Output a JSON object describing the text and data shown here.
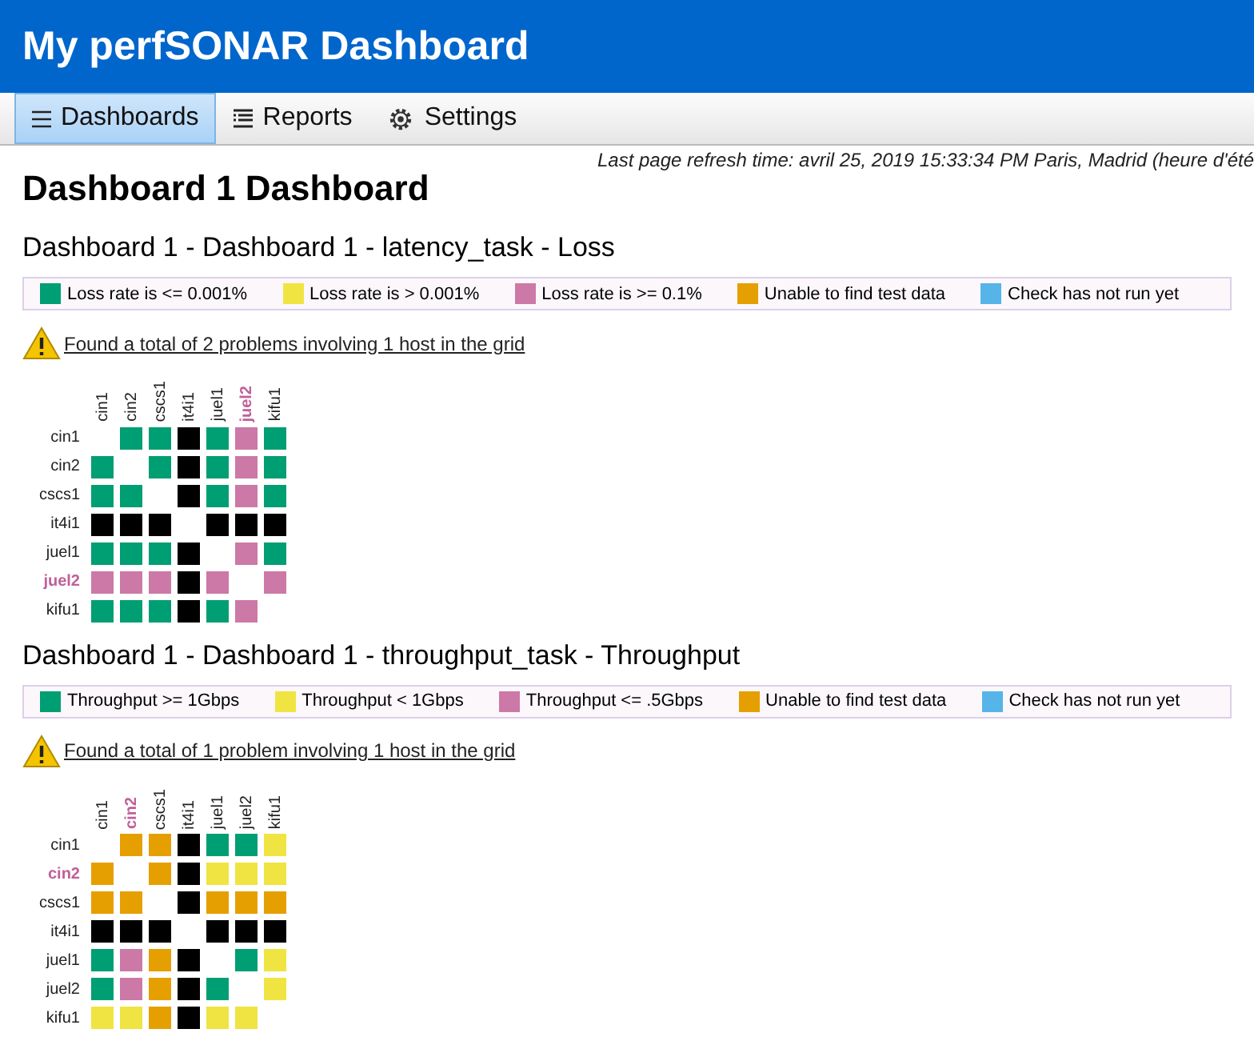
{
  "header": {
    "title": "My perfSONAR Dashboard"
  },
  "nav": [
    {
      "label": "Dashboards",
      "kind": "menu",
      "selected": true
    },
    {
      "label": "Reports",
      "kind": "list",
      "selected": false
    },
    {
      "label": "Settings",
      "kind": "gear",
      "selected": false
    }
  ],
  "refresh_text": "Last page refresh time: avril 25, 2019 15:33:34 PM Paris, Madrid (heure d'été",
  "page_title": "Dashboard 1 Dashboard",
  "sections": [
    {
      "title": "Dashboard 1 - Dashboard 1 - latency_task - Loss",
      "legend": [
        {
          "label": "Loss rate is <= 0.001%",
          "color": "#009e73"
        },
        {
          "label": "Loss rate is > 0.001%",
          "color": "#f0e442"
        },
        {
          "label": "Loss rate is >= 0.1%",
          "color": "#cc79a7"
        },
        {
          "label": "Unable to find test data",
          "color": "#e69f00"
        },
        {
          "label": "Check has not run yet",
          "color": "#56b4e9"
        }
      ],
      "problem_text": "Found a total of 2 problems involving 1 host in the grid",
      "columns": [
        {
          "label": "cin1",
          "flagged": false
        },
        {
          "label": "cin2",
          "flagged": false
        },
        {
          "label": "cscs1",
          "flagged": false
        },
        {
          "label": "it4i1",
          "flagged": false
        },
        {
          "label": "juel1",
          "flagged": false
        },
        {
          "label": "juel2",
          "flagged": true
        },
        {
          "label": "kifu1",
          "flagged": false
        }
      ],
      "rows": [
        {
          "label": "cin1",
          "flagged": false,
          "cells": [
            {
              "kind": "empty"
            },
            {
              "kind": "status",
              "color": "#009e73"
            },
            {
              "kind": "status",
              "color": "#009e73"
            },
            {
              "kind": "status",
              "color": "#000000"
            },
            {
              "kind": "status",
              "color": "#009e73"
            },
            {
              "kind": "status",
              "color": "#cc79a7"
            },
            {
              "kind": "status",
              "color": "#009e73"
            }
          ]
        },
        {
          "label": "cin2",
          "flagged": false,
          "cells": [
            {
              "kind": "status",
              "color": "#009e73"
            },
            {
              "kind": "empty"
            },
            {
              "kind": "status",
              "color": "#009e73"
            },
            {
              "kind": "status",
              "color": "#000000"
            },
            {
              "kind": "status",
              "color": "#009e73"
            },
            {
              "kind": "status",
              "color": "#cc79a7"
            },
            {
              "kind": "status",
              "color": "#009e73"
            }
          ]
        },
        {
          "label": "cscs1",
          "flagged": false,
          "cells": [
            {
              "kind": "status",
              "color": "#009e73"
            },
            {
              "kind": "status",
              "color": "#009e73"
            },
            {
              "kind": "empty"
            },
            {
              "kind": "status",
              "color": "#000000"
            },
            {
              "kind": "status",
              "color": "#009e73"
            },
            {
              "kind": "status",
              "color": "#cc79a7"
            },
            {
              "kind": "status",
              "color": "#009e73"
            }
          ]
        },
        {
          "label": "it4i1",
          "flagged": false,
          "cells": [
            {
              "kind": "status",
              "color": "#000000"
            },
            {
              "kind": "status",
              "color": "#000000"
            },
            {
              "kind": "status",
              "color": "#000000"
            },
            {
              "kind": "empty"
            },
            {
              "kind": "status",
              "color": "#000000"
            },
            {
              "kind": "status",
              "color": "#000000"
            },
            {
              "kind": "status",
              "color": "#000000"
            }
          ]
        },
        {
          "label": "juel1",
          "flagged": false,
          "cells": [
            {
              "kind": "status",
              "color": "#009e73"
            },
            {
              "kind": "status",
              "color": "#009e73"
            },
            {
              "kind": "status",
              "color": "#009e73"
            },
            {
              "kind": "status",
              "color": "#000000"
            },
            {
              "kind": "empty"
            },
            {
              "kind": "status",
              "color": "#cc79a7"
            },
            {
              "kind": "status",
              "color": "#009e73"
            }
          ]
        },
        {
          "label": "juel2",
          "flagged": true,
          "cells": [
            {
              "kind": "status",
              "color": "#cc79a7"
            },
            {
              "kind": "status",
              "color": "#cc79a7"
            },
            {
              "kind": "status",
              "color": "#cc79a7"
            },
            {
              "kind": "status",
              "color": "#000000"
            },
            {
              "kind": "status",
              "color": "#cc79a7"
            },
            {
              "kind": "empty"
            },
            {
              "kind": "status",
              "color": "#cc79a7"
            }
          ]
        },
        {
          "label": "kifu1",
          "flagged": false,
          "cells": [
            {
              "kind": "status",
              "color": "#009e73"
            },
            {
              "kind": "status",
              "color": "#009e73"
            },
            {
              "kind": "status",
              "color": "#009e73"
            },
            {
              "kind": "status",
              "color": "#000000"
            },
            {
              "kind": "status",
              "color": "#009e73"
            },
            {
              "kind": "status",
              "color": "#cc79a7"
            },
            {
              "kind": "empty"
            }
          ]
        }
      ]
    },
    {
      "title": "Dashboard 1 - Dashboard 1 - throughput_task - Throughput",
      "legend": [
        {
          "label": "Throughput >= 1Gbps",
          "color": "#009e73"
        },
        {
          "label": "Throughput < 1Gbps",
          "color": "#f0e442"
        },
        {
          "label": "Throughput <= .5Gbps",
          "color": "#cc79a7"
        },
        {
          "label": "Unable to find test data",
          "color": "#e69f00"
        },
        {
          "label": "Check has not run yet",
          "color": "#56b4e9"
        }
      ],
      "problem_text": "Found a total of 1 problem involving 1 host in the grid",
      "columns": [
        {
          "label": "cin1",
          "flagged": false
        },
        {
          "label": "cin2",
          "flagged": true
        },
        {
          "label": "cscs1",
          "flagged": false
        },
        {
          "label": "it4i1",
          "flagged": false
        },
        {
          "label": "juel1",
          "flagged": false
        },
        {
          "label": "juel2",
          "flagged": false
        },
        {
          "label": "kifu1",
          "flagged": false
        }
      ],
      "rows": [
        {
          "label": "cin1",
          "flagged": false,
          "cells": [
            {
              "kind": "empty"
            },
            {
              "kind": "status",
              "color": "#e69f00"
            },
            {
              "kind": "status",
              "color": "#e69f00"
            },
            {
              "kind": "status",
              "color": "#000000"
            },
            {
              "kind": "status",
              "color": "#009e73"
            },
            {
              "kind": "status",
              "color": "#009e73"
            },
            {
              "kind": "status",
              "color": "#f0e442"
            }
          ]
        },
        {
          "label": "cin2",
          "flagged": true,
          "cells": [
            {
              "kind": "status",
              "color": "#e69f00"
            },
            {
              "kind": "empty"
            },
            {
              "kind": "status",
              "color": "#e69f00"
            },
            {
              "kind": "status",
              "color": "#000000"
            },
            {
              "kind": "status",
              "color": "#f0e442"
            },
            {
              "kind": "status",
              "color": "#f0e442"
            },
            {
              "kind": "status",
              "color": "#f0e442"
            }
          ]
        },
        {
          "label": "cscs1",
          "flagged": false,
          "cells": [
            {
              "kind": "status",
              "color": "#e69f00"
            },
            {
              "kind": "status",
              "color": "#e69f00"
            },
            {
              "kind": "empty"
            },
            {
              "kind": "status",
              "color": "#000000"
            },
            {
              "kind": "status",
              "color": "#e69f00"
            },
            {
              "kind": "status",
              "color": "#e69f00"
            },
            {
              "kind": "status",
              "color": "#e69f00"
            }
          ]
        },
        {
          "label": "it4i1",
          "flagged": false,
          "cells": [
            {
              "kind": "status",
              "color": "#000000"
            },
            {
              "kind": "status",
              "color": "#000000"
            },
            {
              "kind": "status",
              "color": "#000000"
            },
            {
              "kind": "empty"
            },
            {
              "kind": "status",
              "color": "#000000"
            },
            {
              "kind": "status",
              "color": "#000000"
            },
            {
              "kind": "status",
              "color": "#000000"
            }
          ]
        },
        {
          "label": "juel1",
          "flagged": false,
          "cells": [
            {
              "kind": "status",
              "color": "#009e73"
            },
            {
              "kind": "status",
              "color": "#cc79a7"
            },
            {
              "kind": "status",
              "color": "#e69f00"
            },
            {
              "kind": "status",
              "color": "#000000"
            },
            {
              "kind": "empty"
            },
            {
              "kind": "status",
              "color": "#009e73"
            },
            {
              "kind": "status",
              "color": "#f0e442"
            }
          ]
        },
        {
          "label": "juel2",
          "flagged": false,
          "cells": [
            {
              "kind": "status",
              "color": "#009e73"
            },
            {
              "kind": "status",
              "color": "#cc79a7"
            },
            {
              "kind": "status",
              "color": "#e69f00"
            },
            {
              "kind": "status",
              "color": "#000000"
            },
            {
              "kind": "status",
              "color": "#009e73"
            },
            {
              "kind": "empty"
            },
            {
              "kind": "status",
              "color": "#f0e442"
            }
          ]
        },
        {
          "label": "kifu1",
          "flagged": false,
          "cells": [
            {
              "kind": "status",
              "color": "#f0e442"
            },
            {
              "kind": "status",
              "color": "#f0e442"
            },
            {
              "kind": "status",
              "color": "#e69f00"
            },
            {
              "kind": "status",
              "color": "#000000"
            },
            {
              "kind": "status",
              "color": "#f0e442"
            },
            {
              "kind": "status",
              "color": "#f0e442"
            },
            {
              "kind": "empty"
            }
          ]
        }
      ]
    }
  ]
}
